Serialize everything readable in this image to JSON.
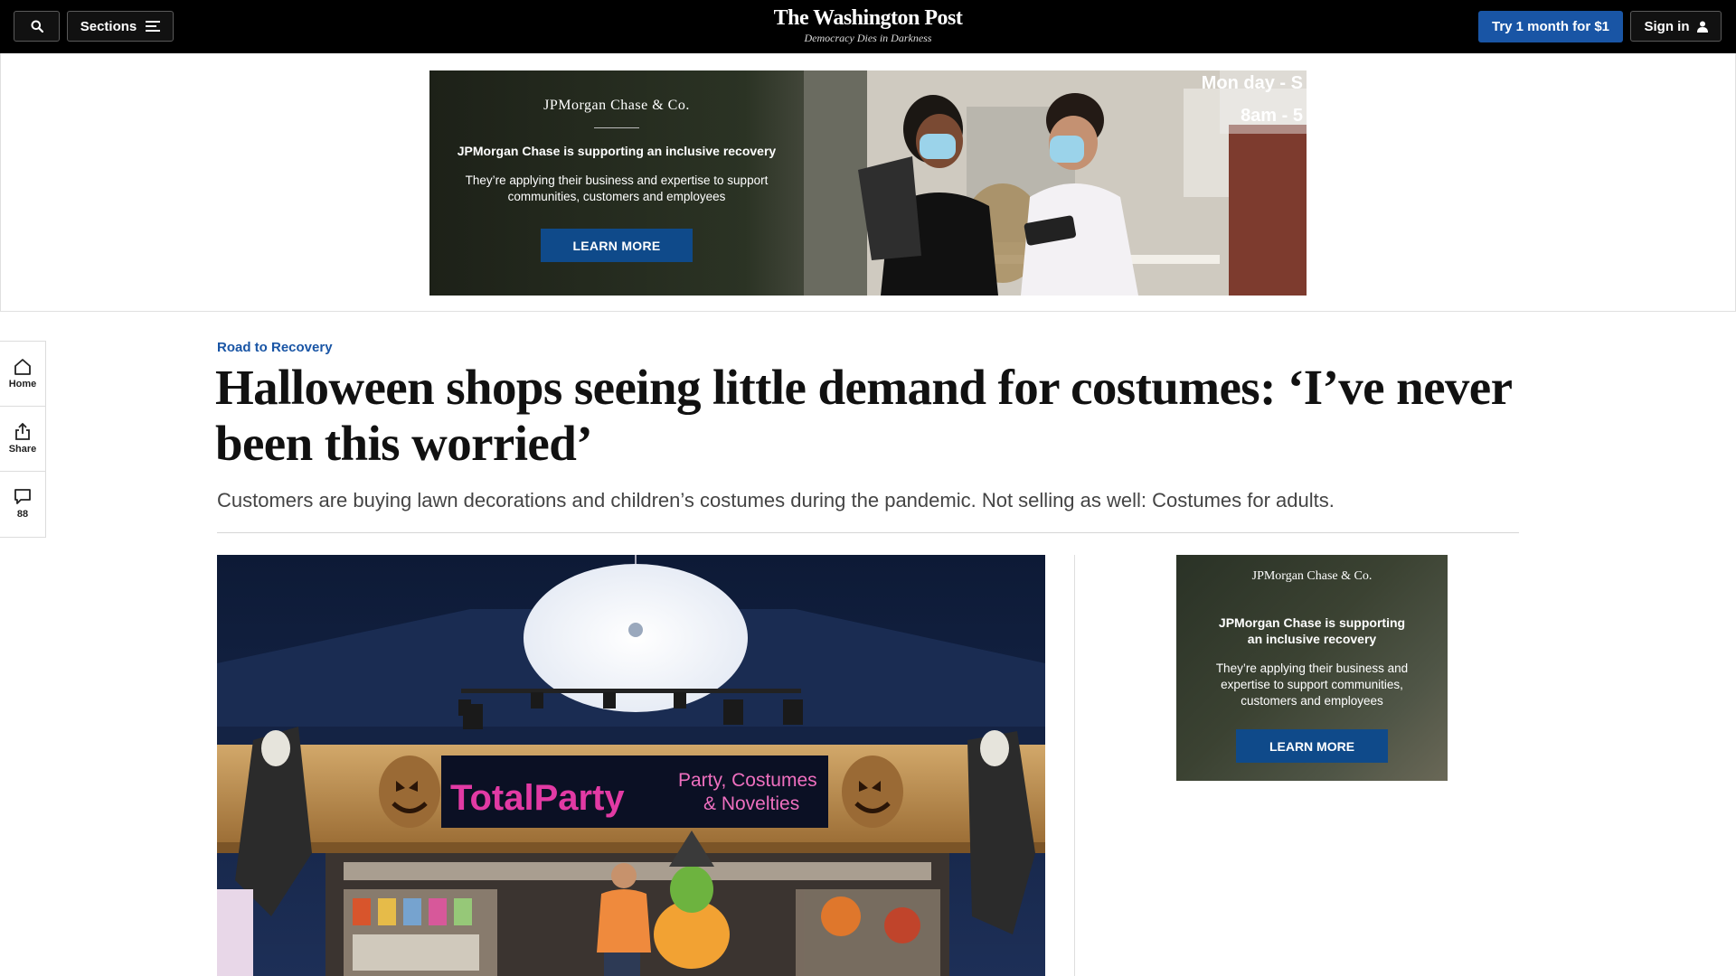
{
  "header": {
    "sections_label": "Sections",
    "brand_name": "The Washington Post",
    "tagline": "Democracy Dies in Darkness",
    "subscribe_label": "Try 1 month for $1",
    "signin_label": "Sign in"
  },
  "top_ad": {
    "logo": "JPMorgan Chase & Co.",
    "headline": "JPMorgan Chase is supporting an inclusive recovery",
    "body": "They’re applying their business and expertise to support communities, customers and employees",
    "cta": "LEARN MORE",
    "sign_line1": "Mon day - S",
    "sign_line2": "8am - 5"
  },
  "rail": {
    "home_label": "Home",
    "share_label": "Share",
    "comments_count": "88"
  },
  "article": {
    "kicker": "Road to Recovery",
    "headline": "Halloween shops seeing little demand for costumes: ‘I’ve never been this worried’",
    "dek": "Customers are buying lawn decorations and children’s costumes during the pandemic. Not selling as well: Costumes for adults."
  },
  "hero_photo": {
    "store_name": "TotalParty",
    "store_tagline_1": "Party, Costumes",
    "store_tagline_2": "& Novelties"
  },
  "side_ad": {
    "logo": "JPMorgan Chase & Co.",
    "headline_1": "JPMorgan Chase is supporting",
    "headline_2": "an inclusive recovery",
    "body": "They’re applying their business and expertise to support communities, customers and employees",
    "cta": "LEARN MORE"
  },
  "colors": {
    "brand_blue": "#1955a5",
    "ad_cta_blue": "#0f4a8a",
    "topbar": "#000000"
  }
}
